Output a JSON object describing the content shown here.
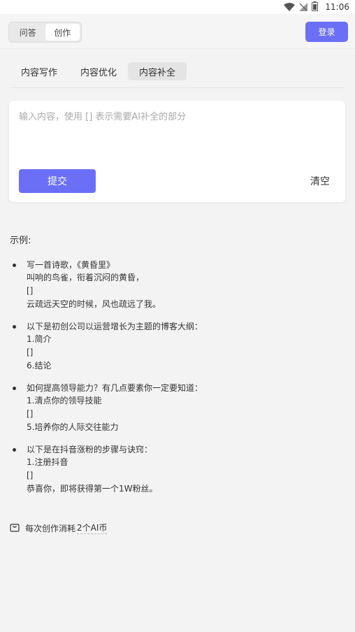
{
  "status_bar": {
    "time": "11:06",
    "icons": [
      "wifi-icon",
      "no-signal-icon",
      "battery-icon"
    ]
  },
  "header": {
    "mode_tabs": [
      {
        "label": "问答",
        "active": false
      },
      {
        "label": "创作",
        "active": true
      }
    ],
    "login_label": "登录"
  },
  "sub_tabs": [
    {
      "label": "内容写作",
      "active": false
    },
    {
      "label": "内容优化",
      "active": false
    },
    {
      "label": "内容补全",
      "active": true
    }
  ],
  "editor": {
    "value": "",
    "placeholder": "输入内容，使用 [] 表示需要AI补全的部分",
    "submit_label": "提交",
    "clear_label": "清空"
  },
  "examples": {
    "title": "示例:",
    "items": [
      {
        "lines": [
          "写一首诗歌，《黄昏里》",
          "叫响的鸟雀，衔着沉闷的黄昏，",
          "[]",
          "云疏远天空的时候，风也疏远了我。"
        ]
      },
      {
        "lines": [
          "以下是初创公司以运营增长为主题的博客大纲：",
          "1.简介",
          "[]",
          "6.结论"
        ]
      },
      {
        "lines": [
          "如何提高领导能力？有几点要素你一定要知道：",
          "1.清点你的领导技能",
          "[]",
          "5.培养你的人际交往能力"
        ]
      },
      {
        "lines": [
          "以下是在抖音涨粉的步骤与诀窍：",
          "1.注册抖音",
          "[]",
          "恭喜你，即将获得第一个1W粉丝。"
        ]
      }
    ]
  },
  "cost": {
    "prefix": "每次创作消耗",
    "value": "2个AI币"
  },
  "colors": {
    "accent": "#6b6ff6",
    "background": "#f3f3f3"
  }
}
